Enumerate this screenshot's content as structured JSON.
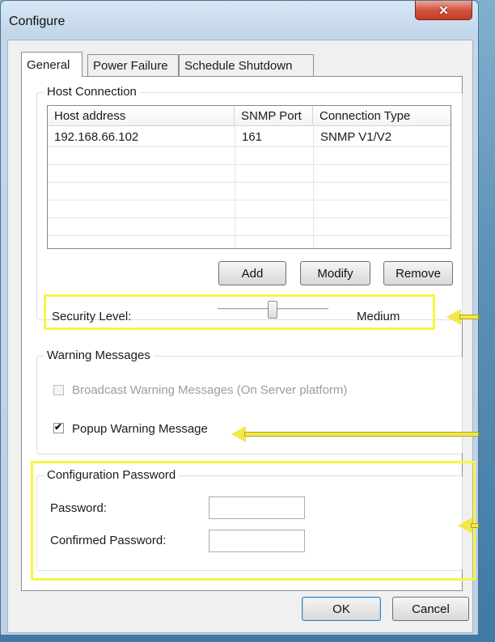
{
  "window": {
    "title": "Configure",
    "close_glyph": "✕"
  },
  "tabs": [
    {
      "label": "General",
      "active": true
    },
    {
      "label": "Power Failure",
      "active": false
    },
    {
      "label": "Schedule Shutdown",
      "active": false
    }
  ],
  "host_connection": {
    "group_label": "Host Connection",
    "columns": [
      "Host address",
      "SNMP Port",
      "Connection Type"
    ],
    "rows": [
      {
        "host": "192.168.66.102",
        "port": "161",
        "type": "SNMP V1/V2"
      }
    ],
    "buttons": {
      "add": "Add",
      "modify": "Modify",
      "remove": "Remove"
    }
  },
  "security": {
    "label": "Security Level:",
    "value_label": "Medium",
    "level_fraction": 0.5
  },
  "warning": {
    "group_label": "Warning Messages",
    "broadcast_label": "Broadcast Warning Messages (On Server platform)",
    "broadcast_checked": false,
    "broadcast_enabled": false,
    "popup_label": "Popup Warning Message",
    "popup_checked": true,
    "check_glyph": "✔"
  },
  "password": {
    "group_label": "Configuration Password",
    "password_label": "Password:",
    "password_value": "",
    "confirm_label": "Confirmed Password:",
    "confirm_value": ""
  },
  "footer": {
    "ok": "OK",
    "cancel": "Cancel"
  },
  "colors": {
    "highlight": "#f8f545",
    "arrow": "#f1e84a",
    "close_button": "#c53a25"
  }
}
